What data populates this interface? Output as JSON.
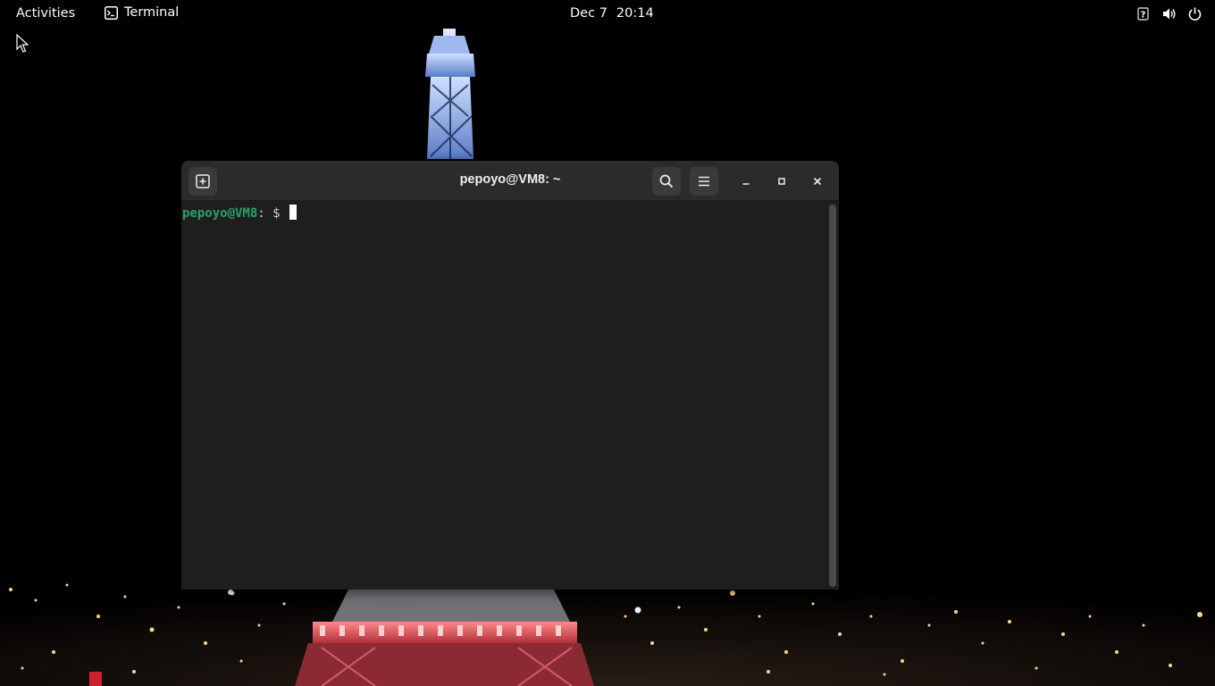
{
  "topbar": {
    "activities_label": "Activities",
    "app_name": "Terminal",
    "clock_date": "Dec 7",
    "clock_time": "20:14",
    "status_icons": [
      "accessibility-question-icon",
      "volume-icon",
      "power-icon"
    ]
  },
  "terminal": {
    "title": "pepoyo@VM8: ~",
    "prompt_user_host": "pepoyo@VM8",
    "prompt_rest": ": $ ",
    "buttons": [
      "new-tab-icon",
      "search-icon",
      "hamburger-menu-icon",
      "minimize-icon",
      "maximize-icon",
      "close-icon"
    ]
  },
  "colors": {
    "topbar_bg": "#000000",
    "terminal_bg": "#1e1e1e",
    "headerbar_bg": "#2b2b2b",
    "prompt_green": "#26a269"
  }
}
